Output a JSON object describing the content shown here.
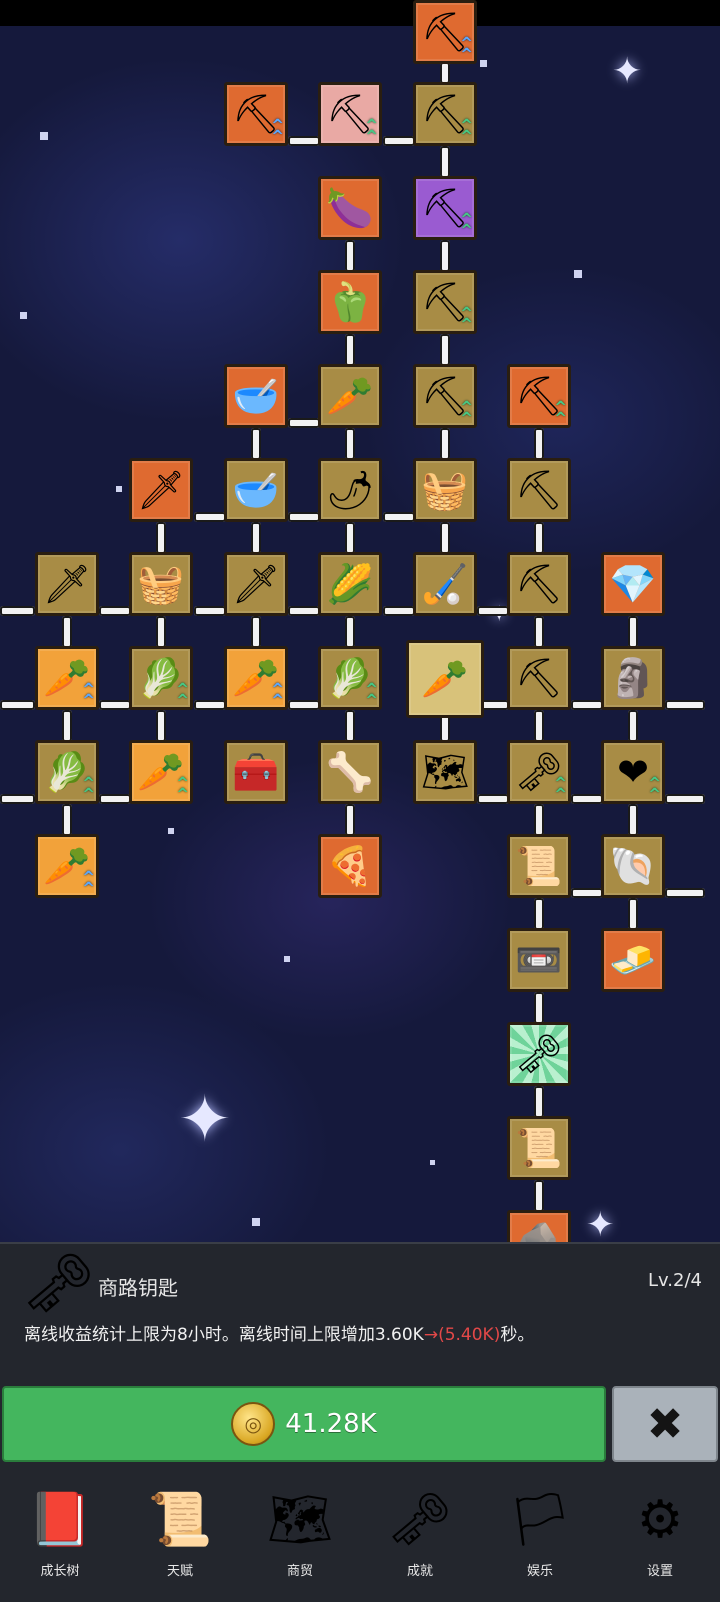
{
  "tree": {
    "selected_node": "carrot-center",
    "nodes": [
      {
        "name": "shovel-top",
        "icon": "shovel-icon",
        "glyph": "⛏",
        "color": "orange",
        "upgrade": "blue"
      },
      {
        "name": "shovel",
        "icon": "shovel-icon",
        "glyph": "⛏",
        "color": "orange",
        "upgrade": "blue"
      },
      {
        "name": "shovel-red",
        "icon": "shovel-icon",
        "glyph": "⛏",
        "color": "pink",
        "upgrade": "green"
      },
      {
        "name": "shovel",
        "icon": "shovel-icon",
        "glyph": "⛏",
        "color": "gold",
        "upgrade": "green"
      },
      {
        "name": "eggplant",
        "icon": "eggplant-icon",
        "glyph": "🍆",
        "color": "orange"
      },
      {
        "name": "shovel-purple",
        "icon": "shovel-icon",
        "glyph": "⛏",
        "color": "purple",
        "upgrade": "green"
      },
      {
        "name": "pepper",
        "icon": "bell-pepper-icon",
        "glyph": "🫑",
        "color": "orange"
      },
      {
        "name": "shovel",
        "icon": "shovel-icon",
        "glyph": "⛏",
        "color": "gold",
        "upgrade": "green"
      },
      {
        "name": "bowl",
        "icon": "soup-bowl-icon",
        "glyph": "🥣",
        "color": "orange"
      },
      {
        "name": "radish",
        "icon": "radish-icon",
        "glyph": "🥕",
        "color": "gold"
      },
      {
        "name": "shovel",
        "icon": "shovel-icon",
        "glyph": "⛏",
        "color": "gold",
        "upgrade": "green"
      },
      {
        "name": "pickaxe",
        "icon": "pickaxe-icon",
        "glyph": "⛏",
        "color": "orange",
        "upgrade": "green"
      },
      {
        "name": "sword-gold",
        "icon": "sword-icon",
        "glyph": "🗡",
        "color": "orange"
      },
      {
        "name": "bowl",
        "icon": "bowl-icon",
        "glyph": "🥣",
        "color": "gold"
      },
      {
        "name": "chili",
        "icon": "chili-icon",
        "glyph": "🌶",
        "color": "gold"
      },
      {
        "name": "sack",
        "icon": "sack-icon",
        "glyph": "🧺",
        "color": "gold"
      },
      {
        "name": "pickaxe",
        "icon": "pickaxe-icon",
        "glyph": "⛏",
        "color": "gold"
      },
      {
        "name": "sword",
        "icon": "sword-icon",
        "glyph": "🗡",
        "color": "gold"
      },
      {
        "name": "sack",
        "icon": "sack-icon",
        "glyph": "🧺",
        "color": "gold"
      },
      {
        "name": "sword",
        "icon": "sword-icon",
        "glyph": "🗡",
        "color": "gold"
      },
      {
        "name": "corn",
        "icon": "corn-icon",
        "glyph": "🌽",
        "color": "gold"
      },
      {
        "name": "stick",
        "icon": "stick-icon",
        "glyph": "🏑",
        "color": "gold"
      },
      {
        "name": "pickaxe",
        "icon": "pickaxe-icon",
        "glyph": "⛏",
        "color": "gold"
      },
      {
        "name": "crystal",
        "icon": "crystal-icon",
        "glyph": "💎",
        "color": "orange"
      },
      {
        "name": "carrot",
        "icon": "carrot-icon",
        "glyph": "🥕",
        "color": "carrot",
        "upgrade": "blue"
      },
      {
        "name": "cabbage",
        "icon": "cabbage-icon",
        "glyph": "🥬",
        "color": "gold",
        "upgrade": "green"
      },
      {
        "name": "carrot",
        "icon": "carrot-icon",
        "glyph": "🥕",
        "color": "carrot",
        "upgrade": "blue"
      },
      {
        "name": "cabbage",
        "icon": "cabbage-icon",
        "glyph": "🥬",
        "color": "gold",
        "upgrade": "green"
      },
      {
        "name": "carrot-center",
        "icon": "carrot-icon",
        "glyph": "🥕",
        "color": "selected"
      },
      {
        "name": "pickaxe",
        "icon": "pickaxe-icon",
        "glyph": "⛏",
        "color": "gold"
      },
      {
        "name": "statue",
        "icon": "statue-icon",
        "glyph": "🗿",
        "color": "gold"
      },
      {
        "name": "cabbage",
        "icon": "cabbage-icon",
        "glyph": "🥬",
        "color": "gold",
        "upgrade": "green"
      },
      {
        "name": "carrot",
        "icon": "carrot-icon",
        "glyph": "🥕",
        "color": "carrot",
        "upgrade": "green"
      },
      {
        "name": "chest",
        "icon": "treasure-chest-icon",
        "glyph": "🧰",
        "color": "gold"
      },
      {
        "name": "bone",
        "icon": "bone-icon",
        "glyph": "🦴",
        "color": "gold"
      },
      {
        "name": "map",
        "icon": "map-icon",
        "glyph": "🗺",
        "color": "gold"
      },
      {
        "name": "key-gold",
        "icon": "key-icon",
        "glyph": "🗝",
        "color": "gold",
        "upgrade": "green"
      },
      {
        "name": "heart",
        "icon": "heart-icon",
        "glyph": "❤",
        "color": "gold",
        "upgrade": "green"
      },
      {
        "name": "carrot",
        "icon": "carrot-icon",
        "glyph": "🥕",
        "color": "carrot",
        "upgrade": "blue"
      },
      {
        "name": "pizza",
        "icon": "pizza-icon",
        "glyph": "🍕",
        "color": "orange"
      },
      {
        "name": "scroll",
        "icon": "scroll-icon",
        "glyph": "📜",
        "color": "gold"
      },
      {
        "name": "fossil",
        "icon": "fossil-icon",
        "glyph": "🐚",
        "color": "gold"
      },
      {
        "name": "cassette",
        "icon": "cassette-icon",
        "glyph": "📼",
        "color": "gold"
      },
      {
        "name": "butter",
        "icon": "butter-icon",
        "glyph": "🧈",
        "color": "orange"
      },
      {
        "name": "key-green",
        "icon": "key-icon",
        "glyph": "🗝",
        "color": "green"
      },
      {
        "name": "parchment",
        "icon": "parchment-icon",
        "glyph": "📜",
        "color": "gold"
      },
      {
        "name": "rock",
        "icon": "rock-icon",
        "glyph": "🪨",
        "color": "orange"
      }
    ]
  },
  "item": {
    "icon": "key-icon",
    "icon_glyph": "🗝",
    "name": "商路钥匙",
    "level": "Lv.2/4",
    "desc_before": "离线收益统计上限为8小时。离线时间上限增加3.60K",
    "desc_arrow": "→",
    "desc_new": "(5.40K)",
    "desc_after": "秒。"
  },
  "buy": {
    "coin_icon": "coin-icon",
    "price": "41.28K"
  },
  "close": {
    "icon": "close-icon",
    "glyph": "✖"
  },
  "nav": {
    "items": [
      {
        "label": "成长树",
        "icon": "book-icon",
        "glyph": "📕"
      },
      {
        "label": "天赋",
        "icon": "scroll-icon",
        "glyph": "📜"
      },
      {
        "label": "商贸",
        "icon": "map-icon",
        "glyph": "🗺"
      },
      {
        "label": "成就",
        "icon": "key-icon",
        "glyph": "🗝"
      },
      {
        "label": "娱乐",
        "icon": "banner-icon",
        "glyph": "🏳"
      },
      {
        "label": "设置",
        "icon": "gear-icon",
        "glyph": "⚙"
      }
    ]
  },
  "colors": {
    "green_button": "#44b65e",
    "close_button": "#aab2ba",
    "highlight_red": "#e34848"
  }
}
